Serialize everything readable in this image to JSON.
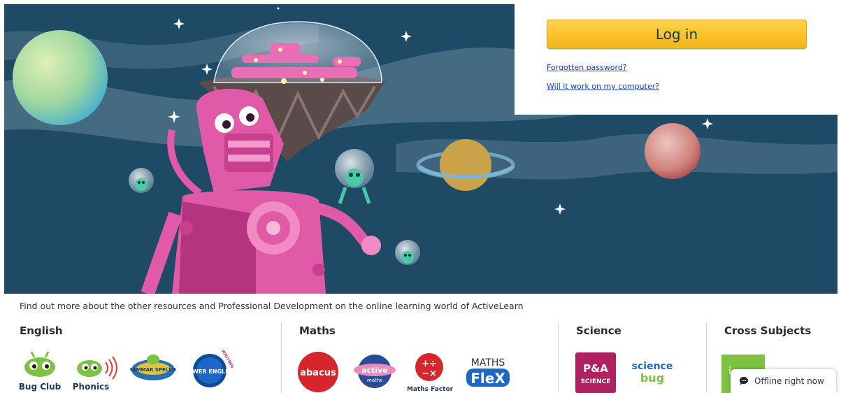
{
  "login": {
    "button_label": "Log in",
    "forgot_label": "Forgotten password?",
    "computer_label": "Will it work on my computer?"
  },
  "intro_text": "Find out more about the other resources and Professional Development on the online learning world of ActiveLearn",
  "sections": {
    "english": {
      "title": "English",
      "logos": {
        "bug_club": "Bug Club",
        "phonics": "Phonics",
        "grammar": "GRAMMAR SPELLING",
        "power_english": "POWER ENGLISH",
        "power_english_tag": "WRITING"
      }
    },
    "maths": {
      "title": "Maths",
      "logos": {
        "abacus": "abacus",
        "active_maths_a": "active",
        "active_maths_b": "maths",
        "maths_factor": "Maths Factor",
        "maths_flex_top": "MATHS",
        "maths_flex_bottom": "FleX"
      }
    },
    "science": {
      "title": "Science",
      "logos": {
        "pa_science_top": "P&A",
        "pa_science_bottom": "SCIENCE",
        "science_bug_top": "science",
        "science_bug_bottom": "bug"
      }
    },
    "cross": {
      "title": "Cross Subjects",
      "logos": {
        "green_tile": "i"
      }
    }
  },
  "offline": {
    "label": "Offline right now"
  },
  "colors": {
    "hero_bg": "#1e4a66",
    "login_button": "#fbc12b",
    "link": "#1a3cc5",
    "robot": "#e05aa8",
    "planet_green": "#9dd79a",
    "planet_orange": "#c9a24a",
    "planet_red": "#d96c5f"
  }
}
